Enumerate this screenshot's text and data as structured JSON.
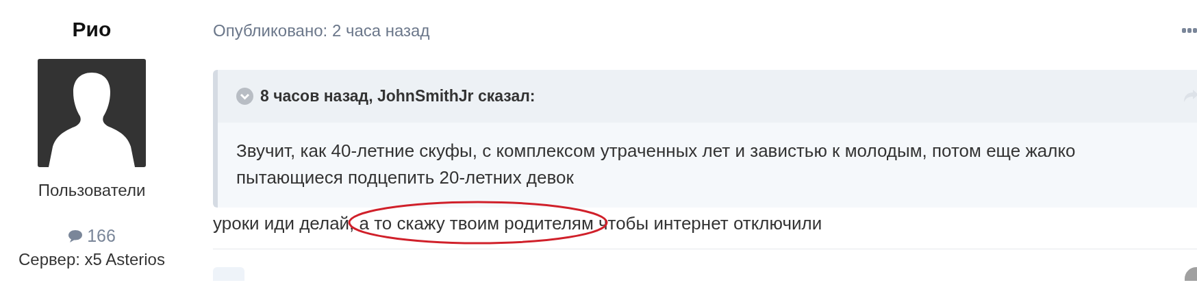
{
  "author": {
    "name": "Рио",
    "group": "Пользователи",
    "posts": "166",
    "server": "Сервер: x5 Asterios"
  },
  "post": {
    "published": "Опубликовано: 2 часа назад",
    "quote": {
      "expanded": true,
      "citation": "8 часов назад, JohnSmithJr сказал:",
      "text": "Звучит, как 40-летние скуфы, с комплексом утраченных лет и завистью к молодым, потом еще жалко пытающиеся подцепить 20-летних девок"
    },
    "body": "уроки иди делай, а то скажу твоим родителям чтобы интернет отключили"
  }
}
